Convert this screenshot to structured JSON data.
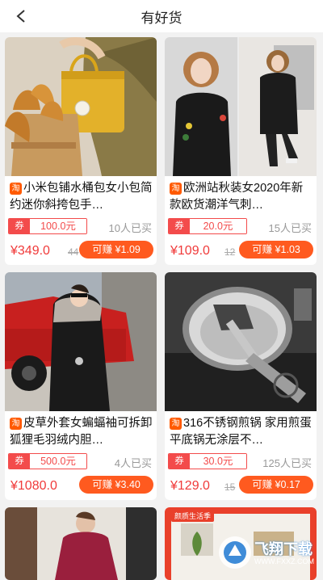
{
  "header": {
    "title": "有好货"
  },
  "tb_badge": "淘",
  "cards": [
    {
      "title": "小米包铺水桶包女小包简约迷你斜挎包手…",
      "coupon_tag": "券",
      "coupon_value": "100.0元",
      "bought": "10人已买",
      "price": "¥349.0",
      "original_price": "44",
      "earn": "可赚 ¥1.09"
    },
    {
      "title": "欧洲站秋装女2020年新款欧货潮洋气刺…",
      "coupon_tag": "券",
      "coupon_value": "20.0元",
      "bought": "15人已买",
      "price": "¥109.0",
      "original_price": "12",
      "earn": "可赚 ¥1.03"
    },
    {
      "title": "皮草外套女蝙蝠袖可拆卸狐狸毛羽绒内胆…",
      "coupon_tag": "券",
      "coupon_value": "500.0元",
      "bought": "4人已买",
      "price": "¥1080.0",
      "original_price": "",
      "earn": "可赚 ¥3.40"
    },
    {
      "title": "316不锈钢煎锅 家用煎蛋平底锅无涂层不…",
      "coupon_tag": "券",
      "coupon_value": "30.0元",
      "bought": "125人已买",
      "price": "¥129.0",
      "original_price": "15",
      "earn": "可赚 ¥0.17"
    }
  ],
  "promo_banner": "颜质生活季",
  "watermark": {
    "text": "飞翔下载",
    "url": "WWW.FXXZ.COM"
  },
  "colors": {
    "accent": "#ff5a1f",
    "price": "#f03a3a",
    "coupon": "#f34b4b",
    "badge": "#ff5a00"
  }
}
